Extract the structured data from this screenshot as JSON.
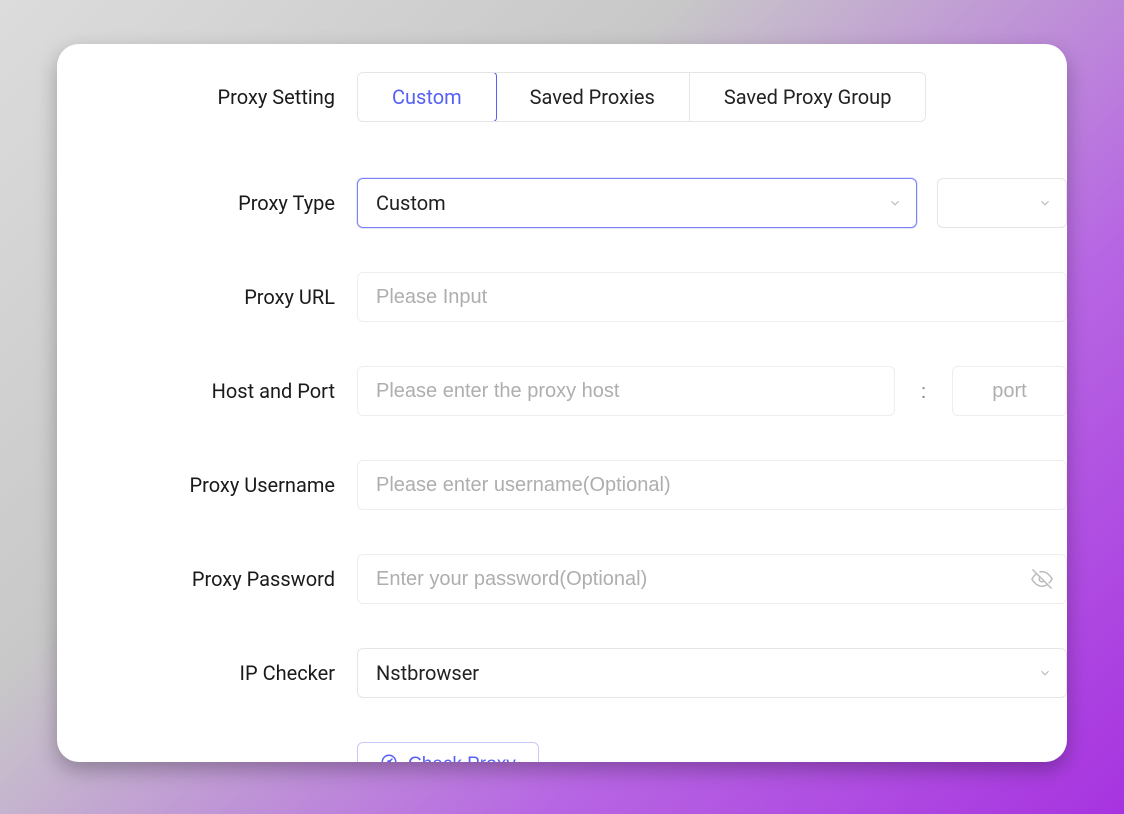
{
  "labels": {
    "proxySetting": "Proxy Setting",
    "proxyType": "Proxy Type",
    "proxyUrl": "Proxy URL",
    "hostPort": "Host and Port",
    "proxyUsername": "Proxy Username",
    "proxyPassword": "Proxy Password",
    "ipChecker": "IP Checker"
  },
  "tabs": {
    "custom": "Custom",
    "savedProxies": "Saved Proxies",
    "savedProxyGroup": "Saved Proxy Group",
    "active": "custom"
  },
  "proxyType": {
    "value": "Custom"
  },
  "proxyUrl": {
    "placeholder": "Please Input",
    "value": ""
  },
  "host": {
    "placeholder": "Please enter the proxy host",
    "value": ""
  },
  "port": {
    "placeholder": "port",
    "value": ""
  },
  "username": {
    "placeholder": "Please enter username(Optional)",
    "value": ""
  },
  "password": {
    "placeholder": "Enter your password(Optional)",
    "value": ""
  },
  "ipChecker": {
    "value": "Nstbrowser"
  },
  "actions": {
    "checkProxy": "Check Proxy"
  }
}
